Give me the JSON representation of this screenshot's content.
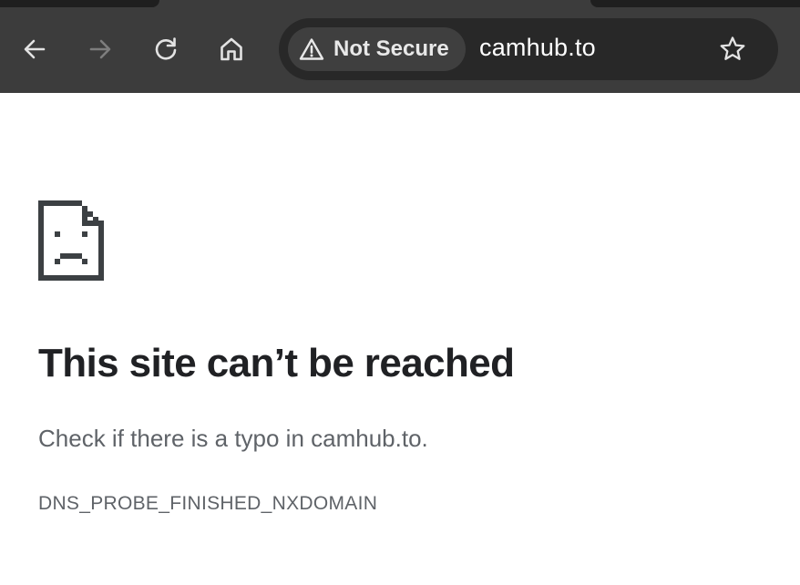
{
  "toolbar": {
    "back_icon": "arrow-left-icon",
    "forward_icon": "arrow-right-icon",
    "reload_icon": "reload-icon",
    "home_icon": "home-icon",
    "forward_enabled": false
  },
  "omnibox": {
    "security_label": "Not Secure",
    "security_icon": "warning-triangle-icon",
    "url": "camhub.to",
    "bookmark_icon": "star-icon"
  },
  "error_page": {
    "icon": "sad-document-icon",
    "heading": "This site can’t be reached",
    "suggestion": "Check if there is a typo in camhub.to.",
    "error_code": "DNS_PROBE_FINISHED_NXDOMAIN"
  },
  "colors": {
    "toolbar_bg": "#3c3c3c",
    "omnibox_bg": "#282828",
    "chip_bg": "#3f3f3f",
    "heading_text": "#202124",
    "body_text": "#5f6368"
  }
}
